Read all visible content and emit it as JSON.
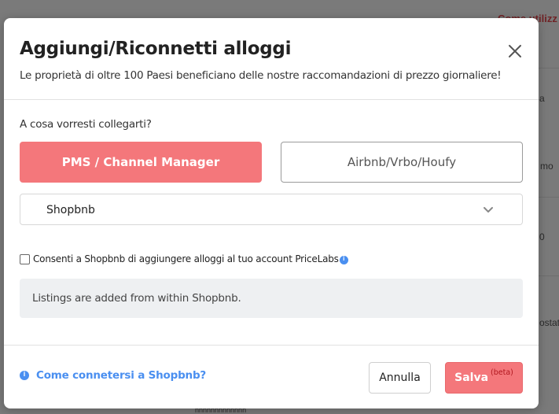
{
  "background": {
    "fragments": [
      "Come utilizz",
      "a",
      "mo",
      "0",
      "ostat",
      "nnnnnnnnnnnnn"
    ]
  },
  "modal": {
    "title": "Aggiungi/Riconnetti alloggi",
    "subtitle": "Le proprietà di oltre 100 Paesi beneficiano delle nostre raccomandazioni di prezzo giornaliere!",
    "question": "A cosa vorresti collegarti?",
    "options": [
      {
        "label": "PMS / Channel Manager",
        "selected": true
      },
      {
        "label": "Airbnb/Vrbo/Houfy",
        "selected": false
      }
    ],
    "select": {
      "value": "Shopbnb"
    },
    "consent": {
      "label": "Consenti a Shopbnb di aggiungere alloggi al tuo account PriceLabs",
      "checked": false
    },
    "note": "Listings are added from within Shopbnb.",
    "footer": {
      "help_link": "Come connetersi a Shopbnb?",
      "cancel_label": "Annulla",
      "save_label": "Salva",
      "save_badge": "(beta)"
    }
  },
  "colors": {
    "accent": "#f4777b",
    "link": "#4a8ff0",
    "badge": "#b0161d"
  },
  "icons": {
    "close": "close-icon",
    "chevron": "chevron-down-icon",
    "info": "info-icon"
  }
}
